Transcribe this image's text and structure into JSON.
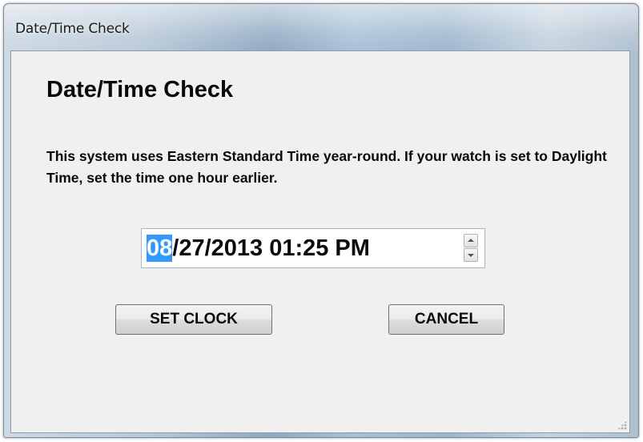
{
  "window": {
    "title": "Date/Time Check"
  },
  "dialog": {
    "heading": "Date/Time Check",
    "message": "This system uses Eastern Standard Time year-round.  If your watch is set to Daylight Time, set the time one hour earlier."
  },
  "datetime_picker": {
    "month_selected": "08",
    "rest": "/27/2013 01:25 PM"
  },
  "buttons": {
    "set_clock": "SET CLOCK",
    "cancel": "CANCEL"
  },
  "icons": {
    "spin_up": "spinner-up-arrow-icon",
    "spin_down": "spinner-down-arrow-icon",
    "resize_grip": "resize-grip-icon"
  },
  "colors": {
    "selection_highlight": "#3399ff",
    "dialog_background": "#f0f0f0"
  }
}
